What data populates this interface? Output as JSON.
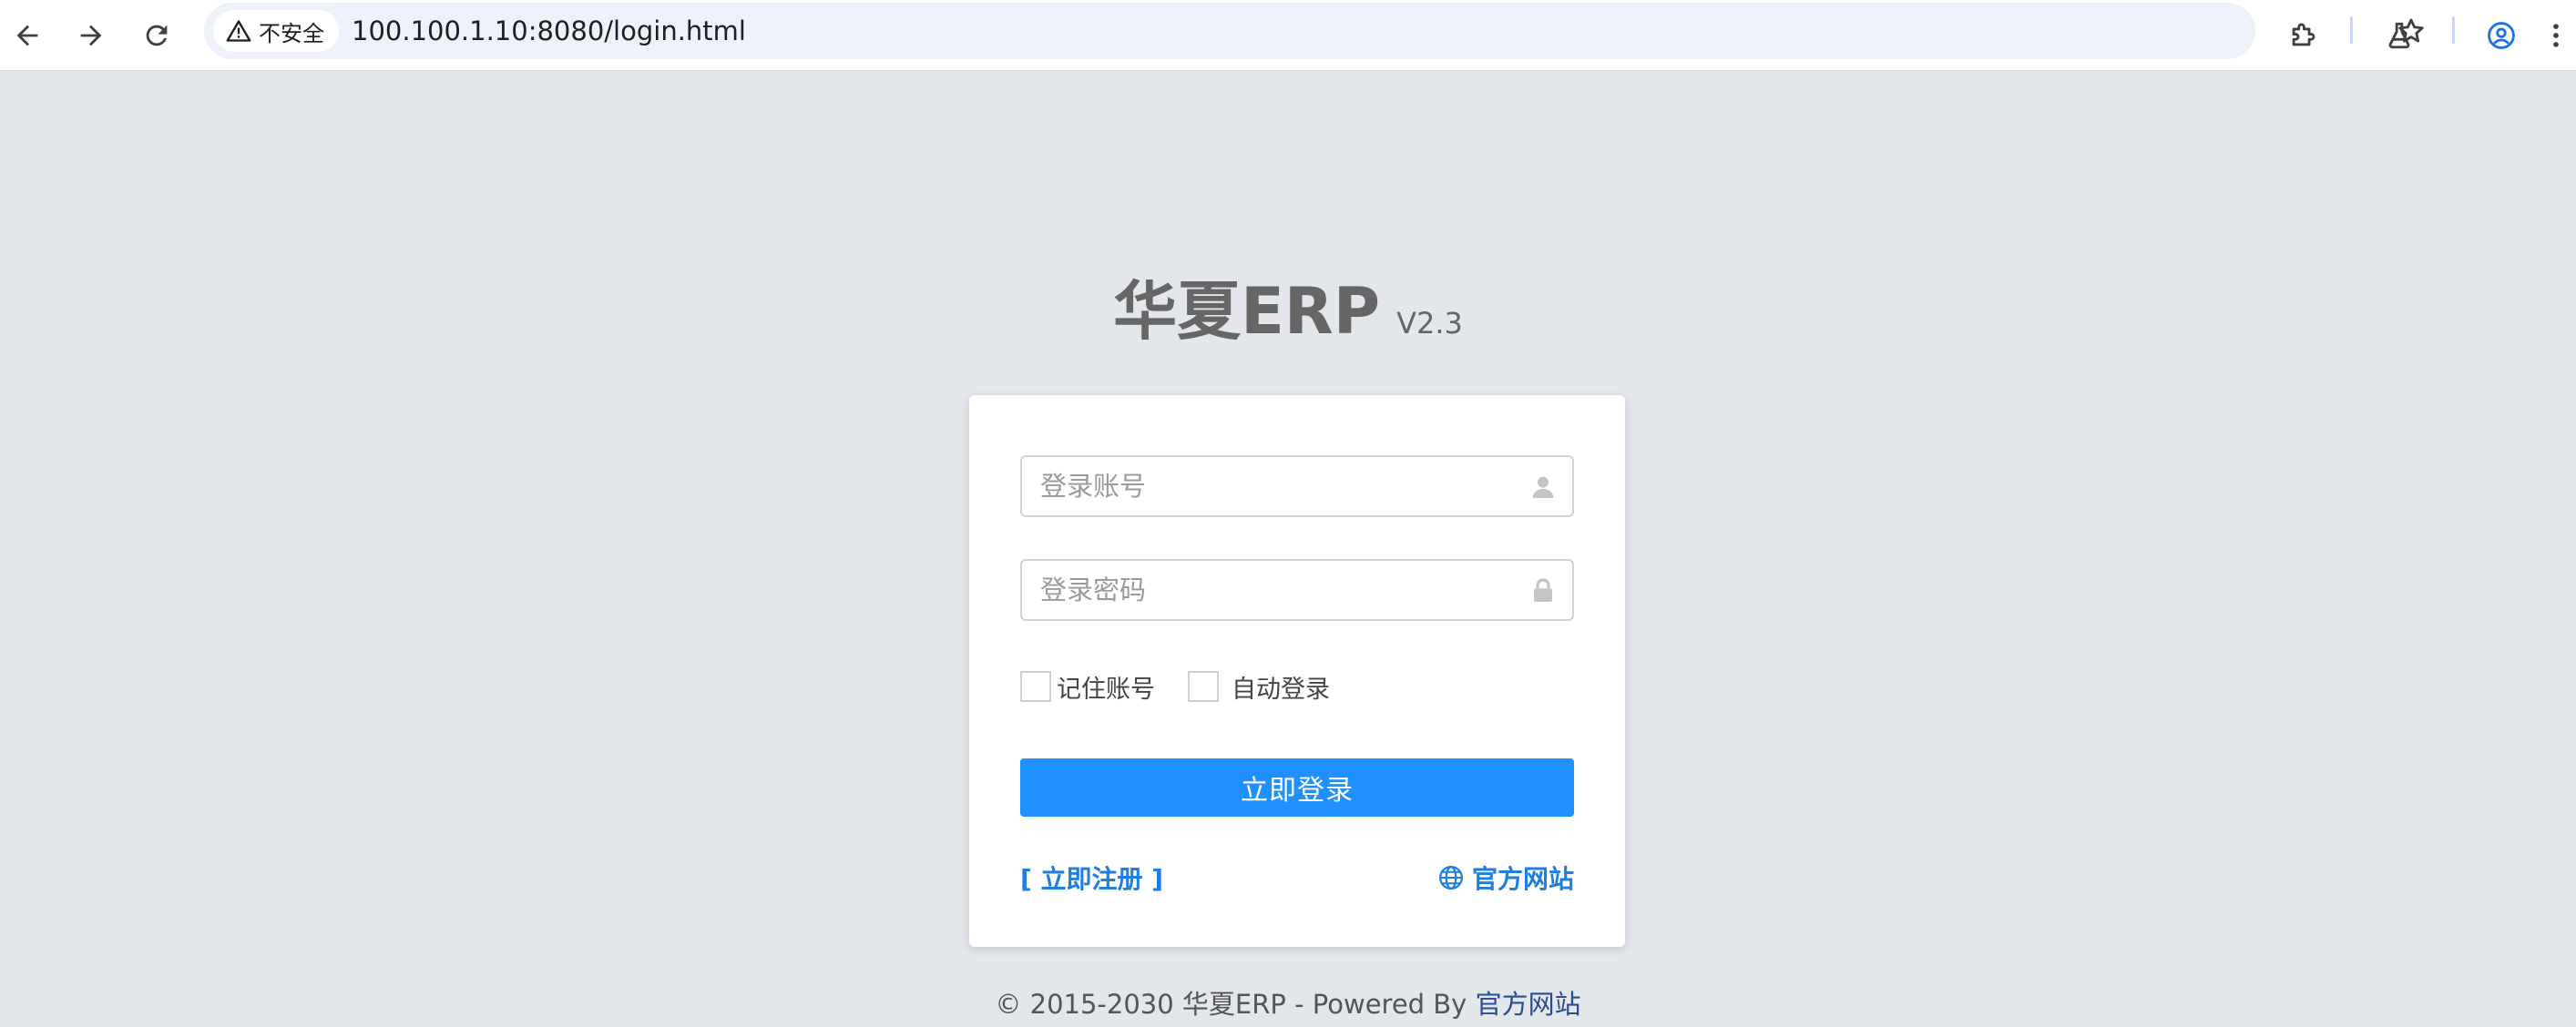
{
  "browser": {
    "security_label": "不安全",
    "url": "100.100.1.10:8080/login.html",
    "icons": {
      "back": "arrow-left-icon",
      "forward": "arrow-right-icon",
      "reload": "reload-icon",
      "warning": "warning-triangle-icon",
      "bookmark": "star-icon",
      "extensions": "puzzle-icon",
      "labs": "flask-icon",
      "profile": "account-circle-icon",
      "menu": "kebab-menu-icon"
    },
    "accent_color": "#1a73e8"
  },
  "brand": {
    "title": "华夏ERP",
    "version": "V2.3"
  },
  "login": {
    "account_placeholder": "登录账号",
    "password_placeholder": "登录密码",
    "remember_label": "记住账号",
    "auto_login_label": "自动登录",
    "submit_label": "立即登录",
    "register_link": "[ 立即注册 ]",
    "official_site_link": "官方网站",
    "button_color": "#1e90ff",
    "link_color": "#1e7fe0"
  },
  "footer": {
    "copyright": "© 2015-2030 华夏ERP - Powered By",
    "link": "官方网站"
  },
  "colors": {
    "page_background": "#e3e6ea",
    "card_background": "#ffffff"
  }
}
